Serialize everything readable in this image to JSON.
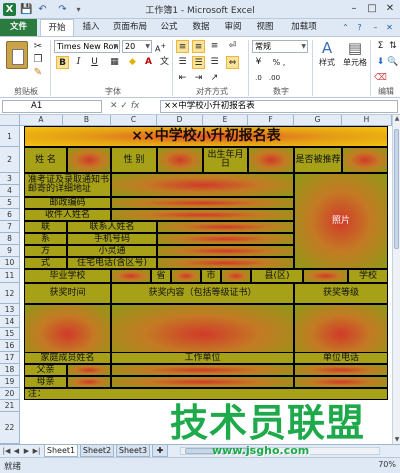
{
  "window": {
    "title": "工作簿1 - Microsoft Excel",
    "logo_text": "X",
    "minimize": "–",
    "maximize": "□",
    "close": "✕"
  },
  "quick_access": {
    "save": "💾",
    "undo": "↶",
    "redo": "↷",
    "more": "▾"
  },
  "tabs": [
    {
      "label": "文件"
    },
    {
      "label": "开始"
    },
    {
      "label": "插入"
    },
    {
      "label": "页面布局"
    },
    {
      "label": "公式"
    },
    {
      "label": "数据"
    },
    {
      "label": "审阅"
    },
    {
      "label": "视图"
    },
    {
      "label": "加载项"
    }
  ],
  "ribbon": {
    "clipboard_label": "剪贴板",
    "font_label": "字体",
    "align_label": "对齐方式",
    "number_label": "数字",
    "edit_label": "编辑",
    "font_name": "Times New Ron",
    "font_size": "20",
    "number_format": "常规",
    "number_symbol": "% ,",
    "styles_label": "样式",
    "cells_label": "单元格",
    "bold": "B",
    "italic": "I",
    "underline": "U",
    "font_color_glyph": "A",
    "sigma": "Σ",
    "currency": "¥"
  },
  "formula_bar": {
    "name_box": "A1",
    "fx_label": "fx",
    "content": "××中学校小升初报名表"
  },
  "columns": [
    "A",
    "B",
    "C",
    "D",
    "E",
    "F",
    "G",
    "H"
  ],
  "rows": [
    "1",
    "2",
    "3",
    "4",
    "5",
    "6",
    "7",
    "8",
    "9",
    "10",
    "11",
    "12",
    "13",
    "14",
    "15",
    "16",
    "17",
    "18",
    "19",
    "20",
    "21",
    "22"
  ],
  "form": {
    "title": "××中学校小升初报名表",
    "name": "姓 名",
    "gender": "性 别",
    "birth": "出生年月日",
    "recommend": "是否被推荐",
    "mail_address": "准考证及录取通知书邮寄的详细地址",
    "postcode": "邮政编码",
    "recipient": "收件人姓名",
    "contact_name": "联系人姓名",
    "mobile": "手机号码",
    "phs": "小灵通",
    "home_phone": "住宅电话(含区号)",
    "contact_col": [
      "联",
      "系",
      "方",
      "式"
    ],
    "photo": "照片",
    "school": "毕业学校",
    "province": "省",
    "city": "市",
    "county": "县(区)",
    "school_suffix": "学校",
    "award_time": "获奖时间",
    "award_content": "获奖内容（包括等级证书）",
    "award_level": "获奖等级",
    "family_name": "家庭成员姓名",
    "work_unit": "工作单位",
    "unit_phone": "单位电话",
    "father": "父亲",
    "mother": "母亲",
    "note": "注："
  },
  "sheets": [
    "Sheet1",
    "Sheet2",
    "Sheet3"
  ],
  "status": {
    "ready": "就绪",
    "zoom": "70%"
  },
  "watermark": {
    "text": "技术员联盟",
    "url": "www.jsgho.com"
  }
}
